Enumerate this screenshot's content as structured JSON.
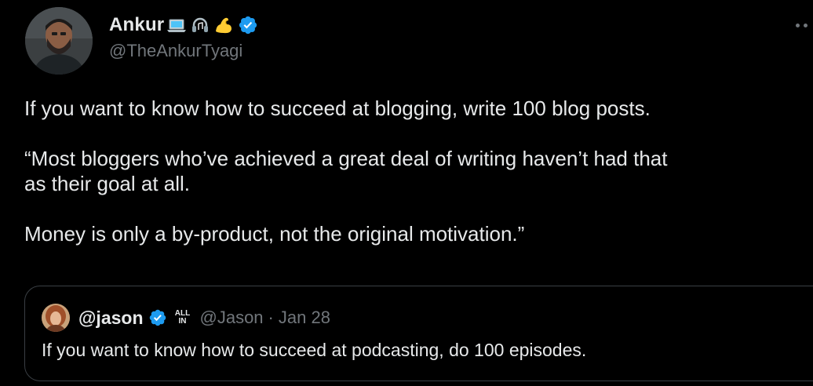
{
  "tweet": {
    "author": {
      "display_name": "Ankur",
      "name_emojis": [
        "laptop-emoji",
        "headphones-emoji",
        "flexed-biceps-emoji"
      ],
      "verified": true,
      "handle": "@TheAnkurTyagi"
    },
    "body": {
      "line1": "If you want to know how to succeed at blogging, write 100 blog posts.",
      "line2": "“Most bloggers who’ve achieved a great deal of writing haven’t had that",
      "line3": "as their goal at all.",
      "line4": "Money is only a by-product, not the original motivation.”"
    },
    "quoted": {
      "display_name": "@jason",
      "verified": true,
      "badge_top": "ALL",
      "badge_bottom": "IN",
      "handle": "@Jason",
      "separator": "·",
      "date": "Jan 28",
      "text": "If you want to know how to succeed at podcasting, do 100 episodes."
    }
  },
  "colors": {
    "background": "#000000",
    "text_primary": "#e7e9ea",
    "text_secondary": "#71767b",
    "verified_blue": "#1d9bf0",
    "quote_border": "#3a3f44"
  },
  "icons": {
    "verified": "verified-badge-icon",
    "more": "more-options-icon"
  }
}
